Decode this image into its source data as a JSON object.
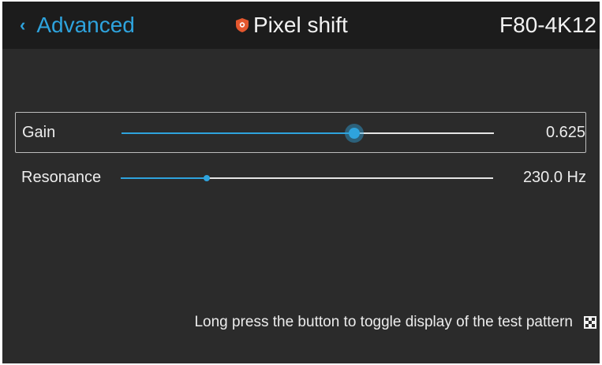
{
  "header": {
    "back_chevron": "‹",
    "back_label": "Advanced",
    "title": "Pixel shift",
    "title_icon": "shield-icon",
    "model": "F80-4K12"
  },
  "settings": [
    {
      "name": "Gain",
      "value_text": "0.625",
      "level": 0.625,
      "selected": true
    },
    {
      "name": "Resonance",
      "value_text": "230.0 Hz",
      "level": 0.23,
      "selected": false
    }
  ],
  "footer": {
    "hint": "Long press the button to toggle display of the test pattern",
    "hint_icon": "test-pattern-icon"
  },
  "colors": {
    "accent": "#2ea3dd",
    "background": "#2b2b2b",
    "header_background": "#1c1c1c",
    "shield": "#e4572e"
  }
}
